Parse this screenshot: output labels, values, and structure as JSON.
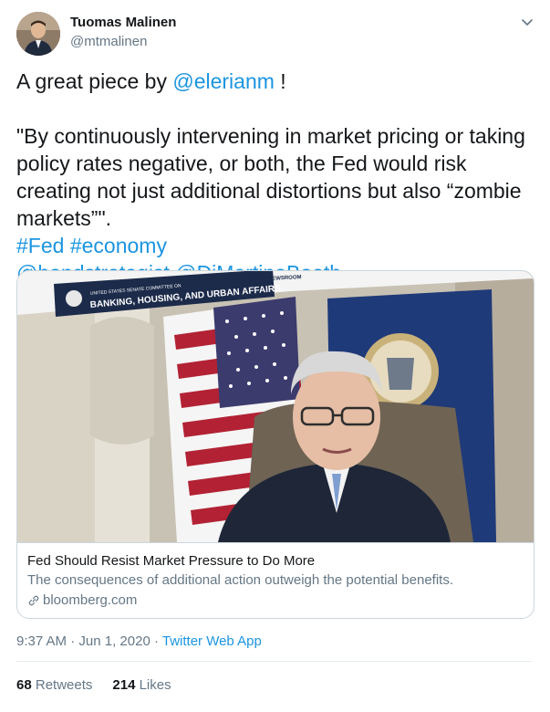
{
  "author": {
    "name": "Tuomas Malinen",
    "handle": "@mtmalinen"
  },
  "tweet": {
    "line1_prefix": "A great piece by ",
    "line1_mention": "@elerianm",
    "line1_suffix": " !",
    "quote": "\"By continuously intervening in market pricing or taking policy rates negative, or both, the Fed would risk creating not just additional distortions but also “zombie markets”\".",
    "hashtag1": "#Fed",
    "hashtag2": "#economy",
    "mention1": "@bondstrategist",
    "mention2": "@DiMartinoBooth"
  },
  "card": {
    "image_banner_small": "UNITED STATES SENATE COMMITTEE ON",
    "image_banner": "BANKING, HOUSING, AND URBAN AFFAIRS",
    "image_newsroom": "NEWSROOM",
    "title": "Fed Should Resist Market Pressure to Do More",
    "description": "The consequences of additional action outweigh the potential benefits.",
    "domain": "bloomberg.com"
  },
  "meta": {
    "time": "9:37 AM",
    "sep1": " · ",
    "date": "Jun 1, 2020",
    "sep2": " · ",
    "app": "Twitter Web App"
  },
  "stats": {
    "retweets_count": "68",
    "retweets_label": "Retweets",
    "likes_count": "214",
    "likes_label": "Likes"
  },
  "colors": {
    "link": "#1b95e0",
    "text": "#14171a",
    "secondary": "#657786",
    "border": "#ccd6dd"
  }
}
